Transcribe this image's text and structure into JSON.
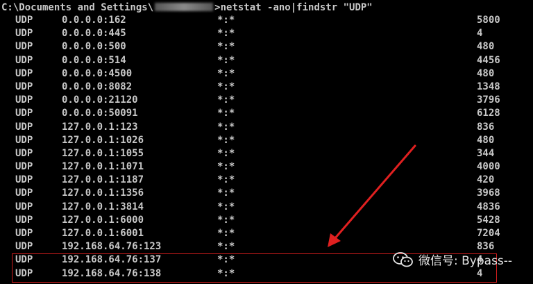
{
  "console": {
    "prompt_path_prefix": "C:\\Documents and Settings\\",
    "prompt_command": ">netstat -ano|findstr \"UDP\"",
    "rows": [
      {
        "proto": "UDP",
        "local": "0.0.0.0:162",
        "foreign": "*:*",
        "pid": "5800"
      },
      {
        "proto": "UDP",
        "local": "0.0.0.0:445",
        "foreign": "*:*",
        "pid": "4"
      },
      {
        "proto": "UDP",
        "local": "0.0.0.0:500",
        "foreign": "*:*",
        "pid": "480"
      },
      {
        "proto": "UDP",
        "local": "0.0.0.0:514",
        "foreign": "*:*",
        "pid": "4456"
      },
      {
        "proto": "UDP",
        "local": "0.0.0.0:4500",
        "foreign": "*:*",
        "pid": "480"
      },
      {
        "proto": "UDP",
        "local": "0.0.0.0:8082",
        "foreign": "*:*",
        "pid": "1348"
      },
      {
        "proto": "UDP",
        "local": "0.0.0.0:21120",
        "foreign": "*:*",
        "pid": "3796"
      },
      {
        "proto": "UDP",
        "local": "0.0.0.0:50091",
        "foreign": "*:*",
        "pid": "6128"
      },
      {
        "proto": "UDP",
        "local": "127.0.0.1:123",
        "foreign": "*:*",
        "pid": "836"
      },
      {
        "proto": "UDP",
        "local": "127.0.0.1:1026",
        "foreign": "*:*",
        "pid": "480"
      },
      {
        "proto": "UDP",
        "local": "127.0.0.1:1055",
        "foreign": "*:*",
        "pid": "344"
      },
      {
        "proto": "UDP",
        "local": "127.0.0.1:1071",
        "foreign": "*:*",
        "pid": "4000"
      },
      {
        "proto": "UDP",
        "local": "127.0.0.1:1187",
        "foreign": "*:*",
        "pid": "420"
      },
      {
        "proto": "UDP",
        "local": "127.0.0.1:1356",
        "foreign": "*:*",
        "pid": "3968"
      },
      {
        "proto": "UDP",
        "local": "127.0.0.1:3814",
        "foreign": "*:*",
        "pid": "4836"
      },
      {
        "proto": "UDP",
        "local": "127.0.0.1:6000",
        "foreign": "*:*",
        "pid": "5428"
      },
      {
        "proto": "UDP",
        "local": "127.0.0.1:6001",
        "foreign": "*:*",
        "pid": "7204"
      },
      {
        "proto": "UDP",
        "local": "192.168.64.76:123",
        "foreign": "*:*",
        "pid": "836"
      },
      {
        "proto": "UDP",
        "local": "192.168.64.76:137",
        "foreign": "*:*",
        "pid": "4"
      },
      {
        "proto": "UDP",
        "local": "192.168.64.76:138",
        "foreign": "*:*",
        "pid": "4"
      }
    ]
  },
  "annotation": {
    "highlight_color": "#d21e1e",
    "arrow_color": "#e02020"
  },
  "watermark": {
    "text": "微信号: Bypass--",
    "icon": "wechat-icon"
  }
}
